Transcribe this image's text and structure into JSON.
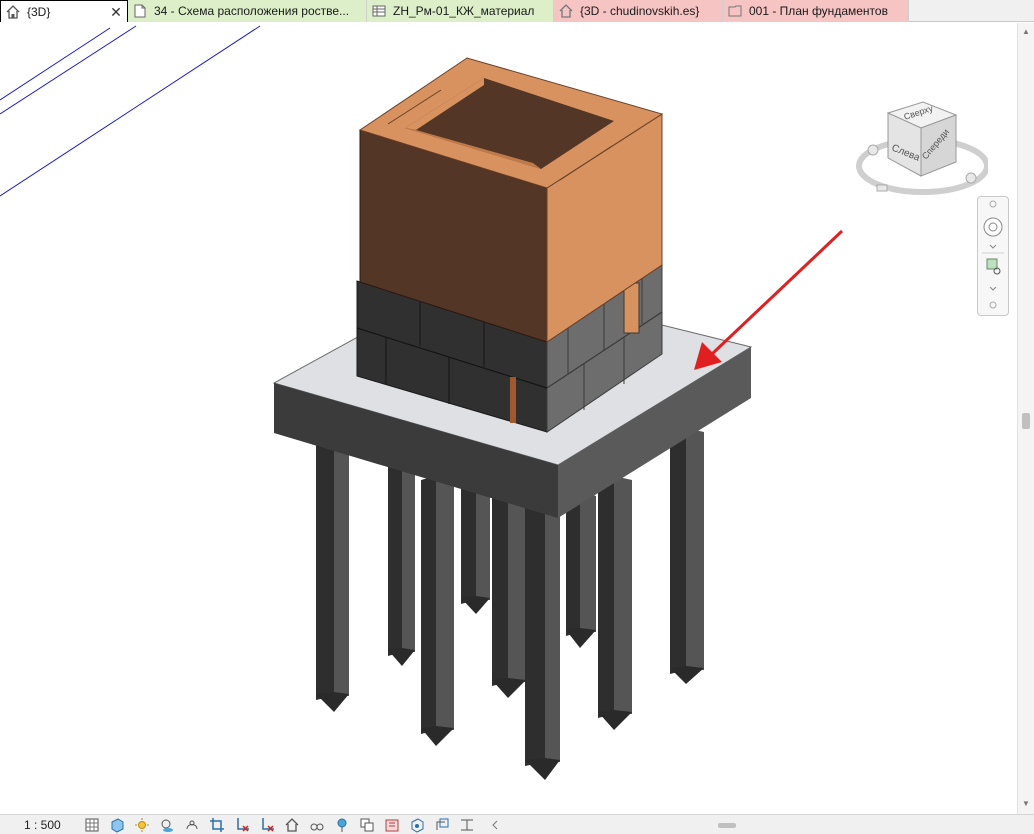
{
  "tabs": [
    {
      "label": "{3D}",
      "icon": "home-3d-icon",
      "active": true,
      "bg": "#ffffff"
    },
    {
      "label": "34 - Схема расположения ростве...",
      "icon": "sheet-icon",
      "active": false,
      "bg": "#dcefc8"
    },
    {
      "label": "ZH_Рм-01_КЖ_материал",
      "icon": "schedule-icon",
      "active": false,
      "bg": "#dcefc8"
    },
    {
      "label": "{3D - chudinovskih.es}",
      "icon": "home-3d-icon",
      "active": false,
      "bg": "#f7c4c4"
    },
    {
      "label": "001 - План фундаментов",
      "icon": "plan-icon",
      "active": false,
      "bg": "#f7c4c4"
    }
  ],
  "viewcube": {
    "top_label": "Сверху",
    "left_label": "Слева",
    "front_label": "Спереди"
  },
  "status": {
    "scale": "1 : 500"
  },
  "statusbar_icons": [
    "detail-level-icon",
    "visual-style-icon",
    "sun-path-icon",
    "shadows-icon",
    "render-icon",
    "crop-view-icon",
    "crop-region-icon",
    "unlock-3d-icon",
    "temporary-hide-icon",
    "reveal-hidden-icon",
    "worksharing-icon",
    "temp-view-properties-icon",
    "analytical-model-icon",
    "highlight-displacement-icon",
    "constraints-icon"
  ],
  "colors": {
    "accent_arrow": "#e02020",
    "brick": "#d7925f",
    "brick_dark": "#533626",
    "block_dark": "#333333",
    "block_light": "#6f6f6f",
    "slab_top": "#dfe0e3",
    "slab_front": "#3b3b3b",
    "slab_side": "#5a5a5a"
  }
}
